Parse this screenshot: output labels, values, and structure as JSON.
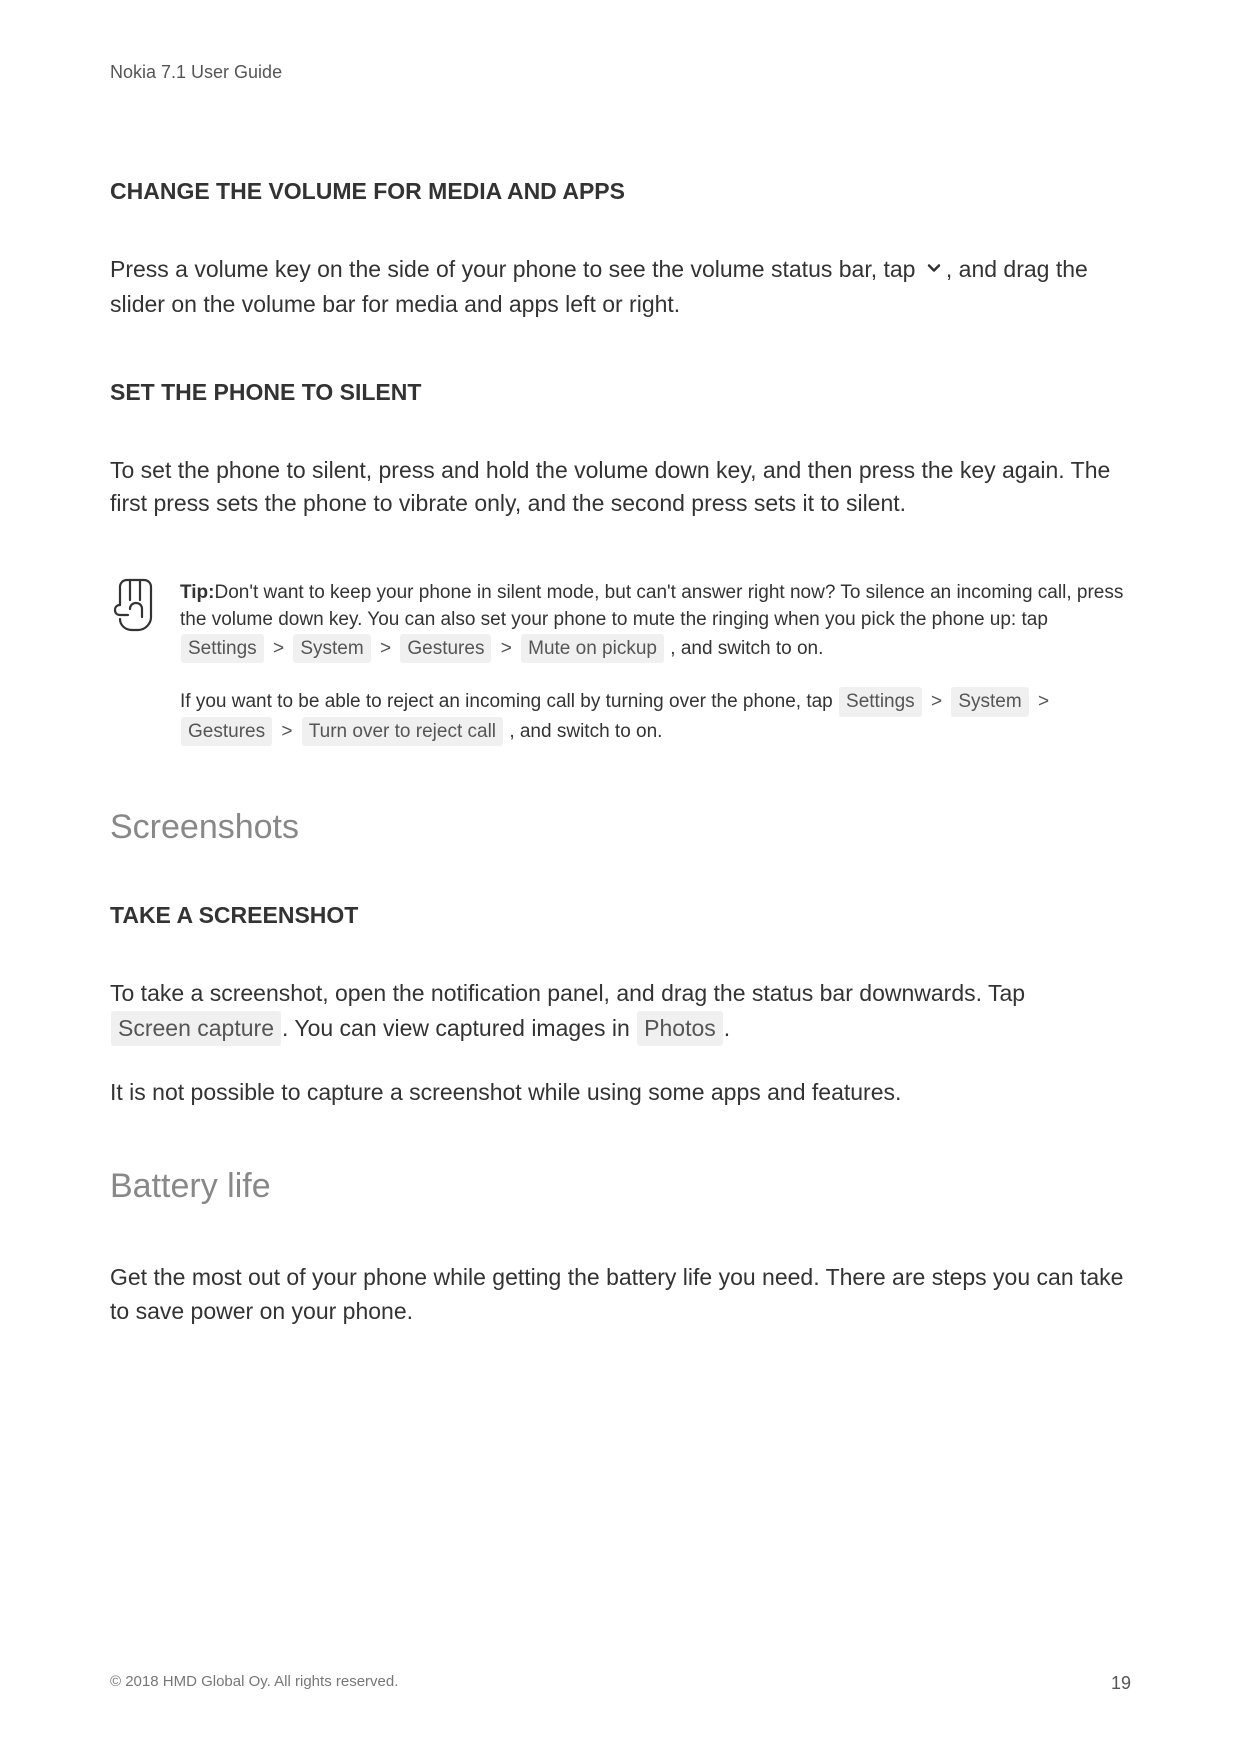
{
  "header": {
    "title": "Nokia 7.1 User Guide"
  },
  "section1": {
    "heading": "CHANGE THE VOLUME FOR MEDIA AND APPS",
    "para_part1": "Press a volume key on the side of your phone to see the volume status bar, tap ",
    "para_part2": ", and drag the slider on the volume bar for media and apps left or right."
  },
  "section2": {
    "heading": "SET THE PHONE TO SILENT",
    "para": "To set the phone to silent, press and hold the volume down key, and then press the key again. The first press sets the phone to vibrate only, and the second press sets it to silent."
  },
  "tip": {
    "label": "Tip:",
    "p1_part1": "Don't want to keep your phone in silent mode, but can't answer right now? To silence an incoming call, press the volume down key. You can also set your phone to mute the ringing when you pick the phone up: tap ",
    "p1_settings": "Settings",
    "p1_system": "System",
    "p1_gestures": "Gestures",
    "p1_mute": "Mute on pickup",
    "p1_part2": ", and switch to on.",
    "p2_part1": "If you want to be able to reject an incoming call  by turning over the phone, tap ",
    "p2_settings": "Settings",
    "p2_system": "System",
    "p2_gestures": "Gestures",
    "p2_turnover": "Turn over to reject call",
    "p2_part2": ", and switch to on.",
    "sep": ">"
  },
  "screenshots": {
    "h2": "Screenshots",
    "heading": "TAKE A SCREENSHOT",
    "p1_part1": "To take a screenshot, open the notification panel, and drag the status bar downwards. Tap ",
    "p1_pill1": "Screen capture",
    "p1_part2": ". You can view captured images in ",
    "p1_pill2": "Photos",
    "p1_part3": ".",
    "p2": "It is not possible to capture a screenshot while using some apps and features."
  },
  "battery": {
    "h2": "Battery life",
    "p1": "Get the most out of your phone while getting the battery life you need. There are steps you can take to save power on your phone."
  },
  "footer": {
    "copyright": "© 2018 HMD Global Oy. All rights reserved.",
    "page": "19"
  }
}
